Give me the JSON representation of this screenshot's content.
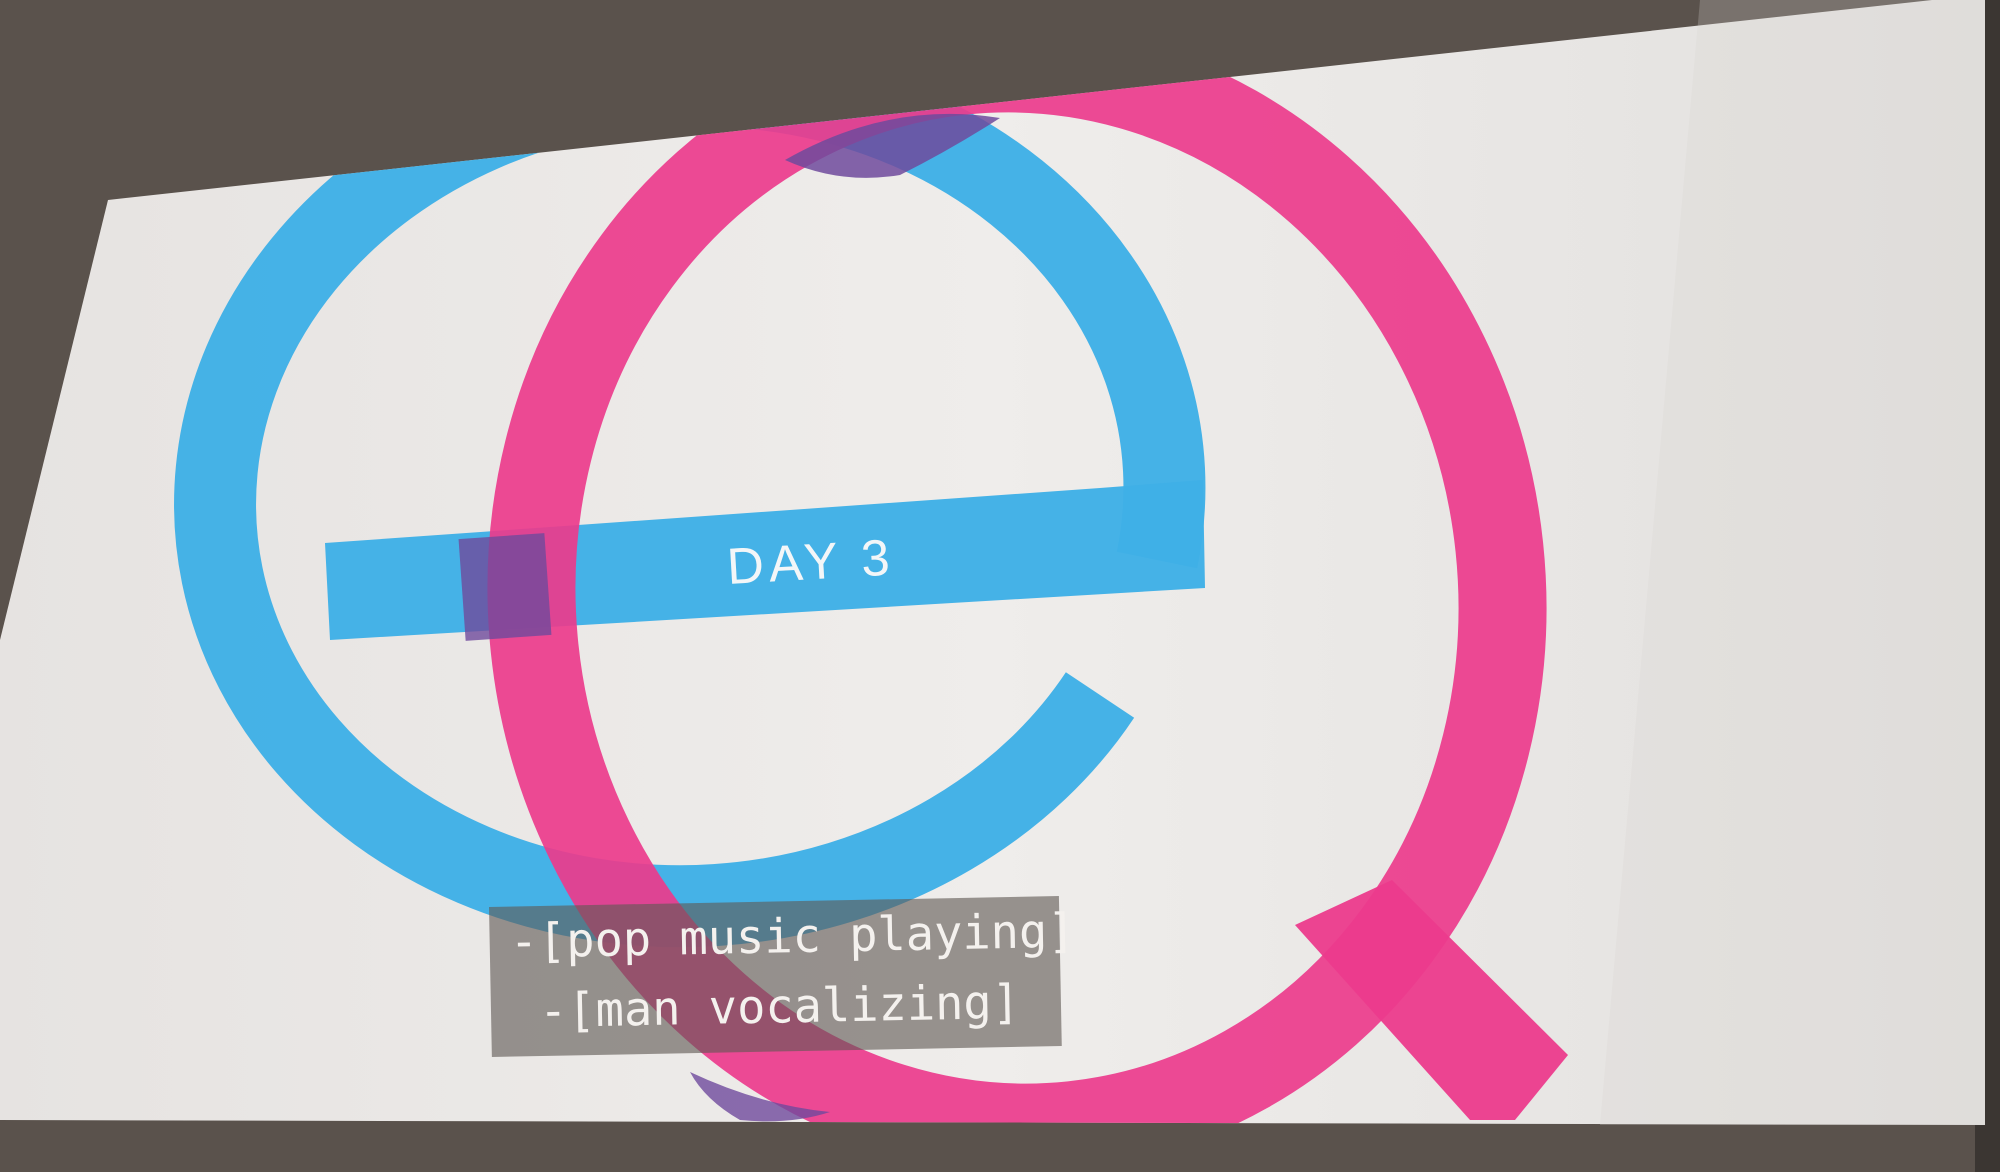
{
  "slide": {
    "title": "DAY 3",
    "logo_letters": [
      "e",
      "Q"
    ],
    "colors": {
      "background": "#eceae8",
      "surround": "#5e5650",
      "cyan": "#3fb0e6",
      "magenta": "#ec3b8c",
      "overlap": "#6f4a9c"
    }
  },
  "captions": {
    "line1": "-[pop music playing]",
    "line2": "-[man vocalizing]"
  }
}
